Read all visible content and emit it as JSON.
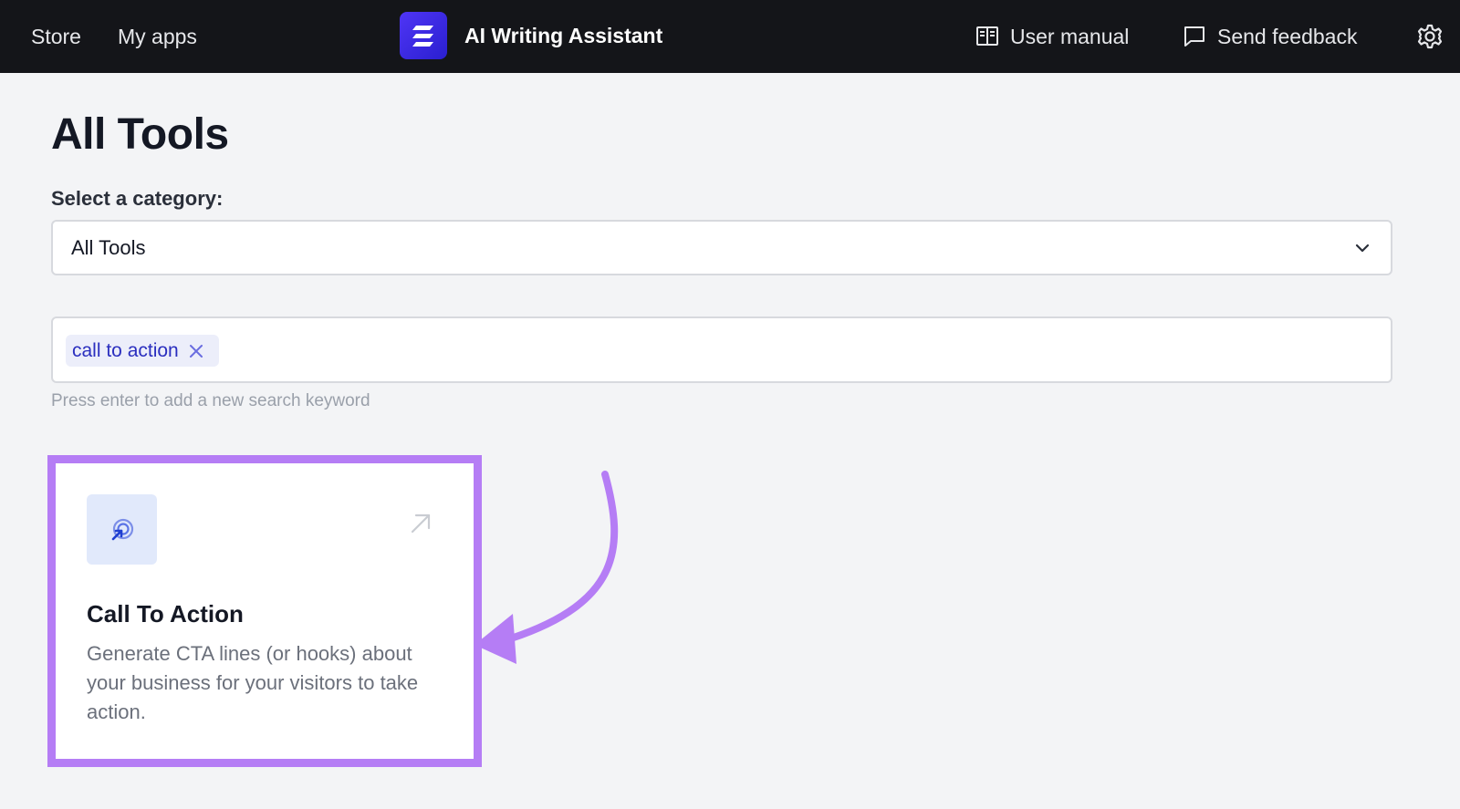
{
  "topbar": {
    "store_label": "Store",
    "my_apps_label": "My apps",
    "app_title": "AI Writing Assistant",
    "user_manual_label": "User manual",
    "send_feedback_label": "Send feedback",
    "icons": {
      "logo": "app-logo-icon",
      "manual": "book-icon",
      "feedback": "chat-bubble-icon",
      "settings": "gear-icon"
    }
  },
  "main": {
    "page_title": "All Tools",
    "category_label": "Select a category:",
    "category_selected": "All Tools",
    "search": {
      "keywords": [
        "call to action"
      ],
      "hint": "Press enter to add a new search keyword"
    }
  },
  "results": [
    {
      "title": "Call To Action",
      "description": "Generate CTA lines (or hooks) about your business for your visitors to take action.",
      "icon": "target-cursor-icon"
    }
  ],
  "colors": {
    "topbar_bg": "#141519",
    "page_bg": "#f3f4f6",
    "accent": "#2b2fbf",
    "highlight": "#b57df5",
    "logo": "#3d2ae8"
  }
}
